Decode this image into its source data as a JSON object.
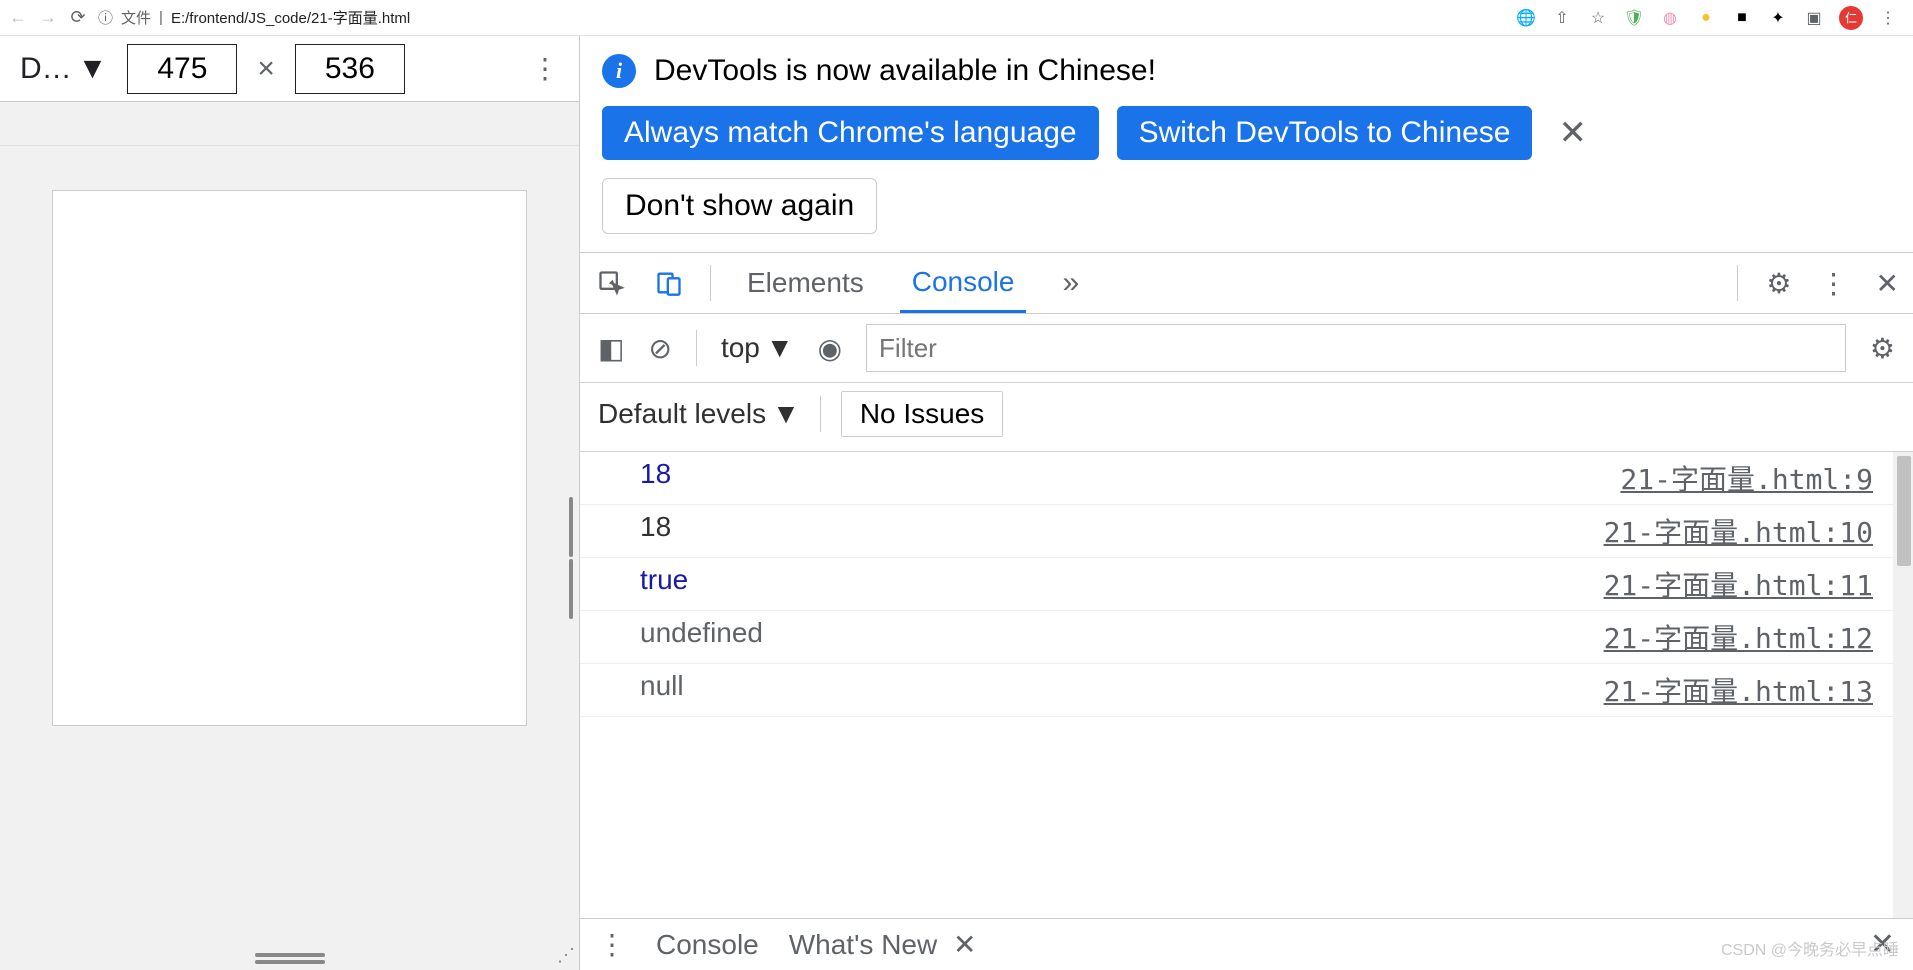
{
  "chrome": {
    "file_label": "文件",
    "url": "E:/frontend/JS_code/21-字面量.html"
  },
  "device_toolbar": {
    "device_label": "D…",
    "width": "475",
    "height": "536"
  },
  "infobar": {
    "message": "DevTools is now available in Chinese!",
    "btn_match": "Always match Chrome's language",
    "btn_switch": "Switch DevTools to Chinese",
    "btn_dont": "Don't show again"
  },
  "tabs": {
    "elements": "Elements",
    "console": "Console"
  },
  "console_ctrl": {
    "context": "top",
    "filter_placeholder": "Filter",
    "levels": "Default levels",
    "issues": "No Issues"
  },
  "logs": [
    {
      "value": "18",
      "cls": "num",
      "src": "21-字面量.html:9"
    },
    {
      "value": "18",
      "cls": "str",
      "src": "21-字面量.html:10"
    },
    {
      "value": "true",
      "cls": "bool",
      "src": "21-字面量.html:11"
    },
    {
      "value": "undefined",
      "cls": "undef",
      "src": "21-字面量.html:12"
    },
    {
      "value": "null",
      "cls": "undef",
      "src": "21-字面量.html:13"
    }
  ],
  "drawer": {
    "console": "Console",
    "whatsnew": "What's New"
  },
  "watermark": "CSDN @今晚务必早点睡"
}
